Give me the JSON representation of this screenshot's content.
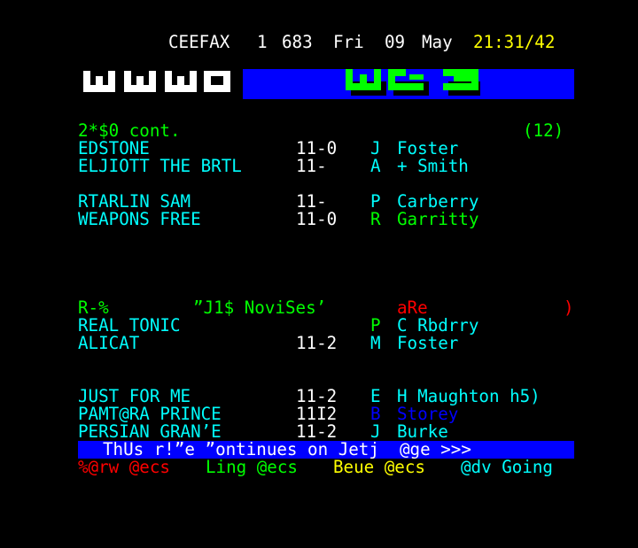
{
  "header": {
    "service": "CEEFAX",
    "magazine": "1",
    "page_number": "683",
    "day": "Fri",
    "date": "09",
    "month": "May",
    "clock": "21:31/42"
  },
  "race": {
    "title": "2*$0 cont.",
    "subpage": "(12)",
    "runners_a": [
      {
        "horse": "EDSTONE",
        "odds": "11-0",
        "jockey_initial": "J",
        "jockey": "Foster"
      },
      {
        "horse": "ELJIOTT THE BRTL",
        "odds": "11-",
        "jockey_initial": "A",
        "jockey": "+ Smith"
      }
    ],
    "runners_b": [
      {
        "horse": "RTARLIN SAM",
        "odds": "11-",
        "jockey_initial": "P",
        "jockey": "Carberry"
      },
      {
        "horse": "WEAPONS FREE",
        "odds": "11-0",
        "jockey_initial": "R",
        "jockey": "Garritty"
      }
    ]
  },
  "race2": {
    "code": "R-%",
    "title": "”J1$ NoviSes’",
    "tag": "aRe",
    "tag_end": ")",
    "runners": [
      {
        "horse": "REAL TONIC",
        "odds": "",
        "jockey_initial": "P",
        "jockey": "C Rbdrry"
      },
      {
        "horse": "ALICAT",
        "odds": "11-2",
        "jockey_initial": "M",
        "jockey": "Foster"
      }
    ]
  },
  "race3": {
    "runners": [
      {
        "horse": "JUST FOR ME",
        "odds": "11-2",
        "jockey_initial": "E",
        "jockey": "H Maughton h5)"
      },
      {
        "horse": "PAMT@RA PRINCE",
        "odds": "11I2",
        "jockey_initial": "B",
        "jockey": "Storey"
      },
      {
        "horse": "PERSIAN GRAN’E",
        "odds": "11-2",
        "jockey_initial": "J",
        "jockey": "Burke"
      }
    ]
  },
  "continue_bar": "ThUs r!”e ”ontinues on Jetj  @ge >>>",
  "fastext": {
    "red": "%@rw @ecs",
    "green": "Ling @ecs",
    "yellow": "Beue @ecs",
    "cyan": "@dv Going"
  },
  "colors": {
    "background": "#000000",
    "white": "#ffffff",
    "yellow": "#ffff00",
    "cyan": "#00ffff",
    "green": "#00ff00",
    "red": "#ff0000",
    "blue": "#0000ff"
  }
}
